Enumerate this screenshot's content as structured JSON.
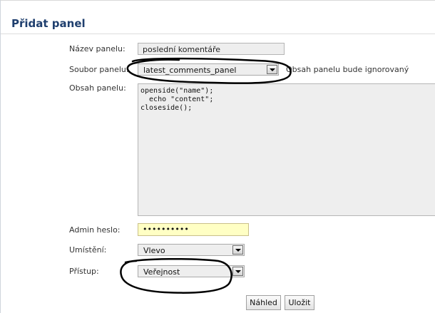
{
  "page": {
    "title": "Přidat panel"
  },
  "form": {
    "name_label": "Název panelu:",
    "name_value": "poslední komentáře",
    "file_label": "Soubor panelu:",
    "file_value": "latest_comments_panel",
    "file_note": "Obsah panelu bude ignorovaný",
    "content_label": "Obsah panelu:",
    "content_value": "opensi​de(\"name\");\n  echo \"content\";\ncloseside();",
    "admin_label": "Admin heslo:",
    "admin_value": "••••••••••",
    "placement_label": "Umístění:",
    "placement_value": "Vlevo",
    "access_label": "Přístup:",
    "access_value": "Veřejnost"
  },
  "buttons": {
    "preview": "Náhled",
    "save": "Uložit"
  },
  "icons": {
    "dropdown": "chevron-down-icon"
  }
}
